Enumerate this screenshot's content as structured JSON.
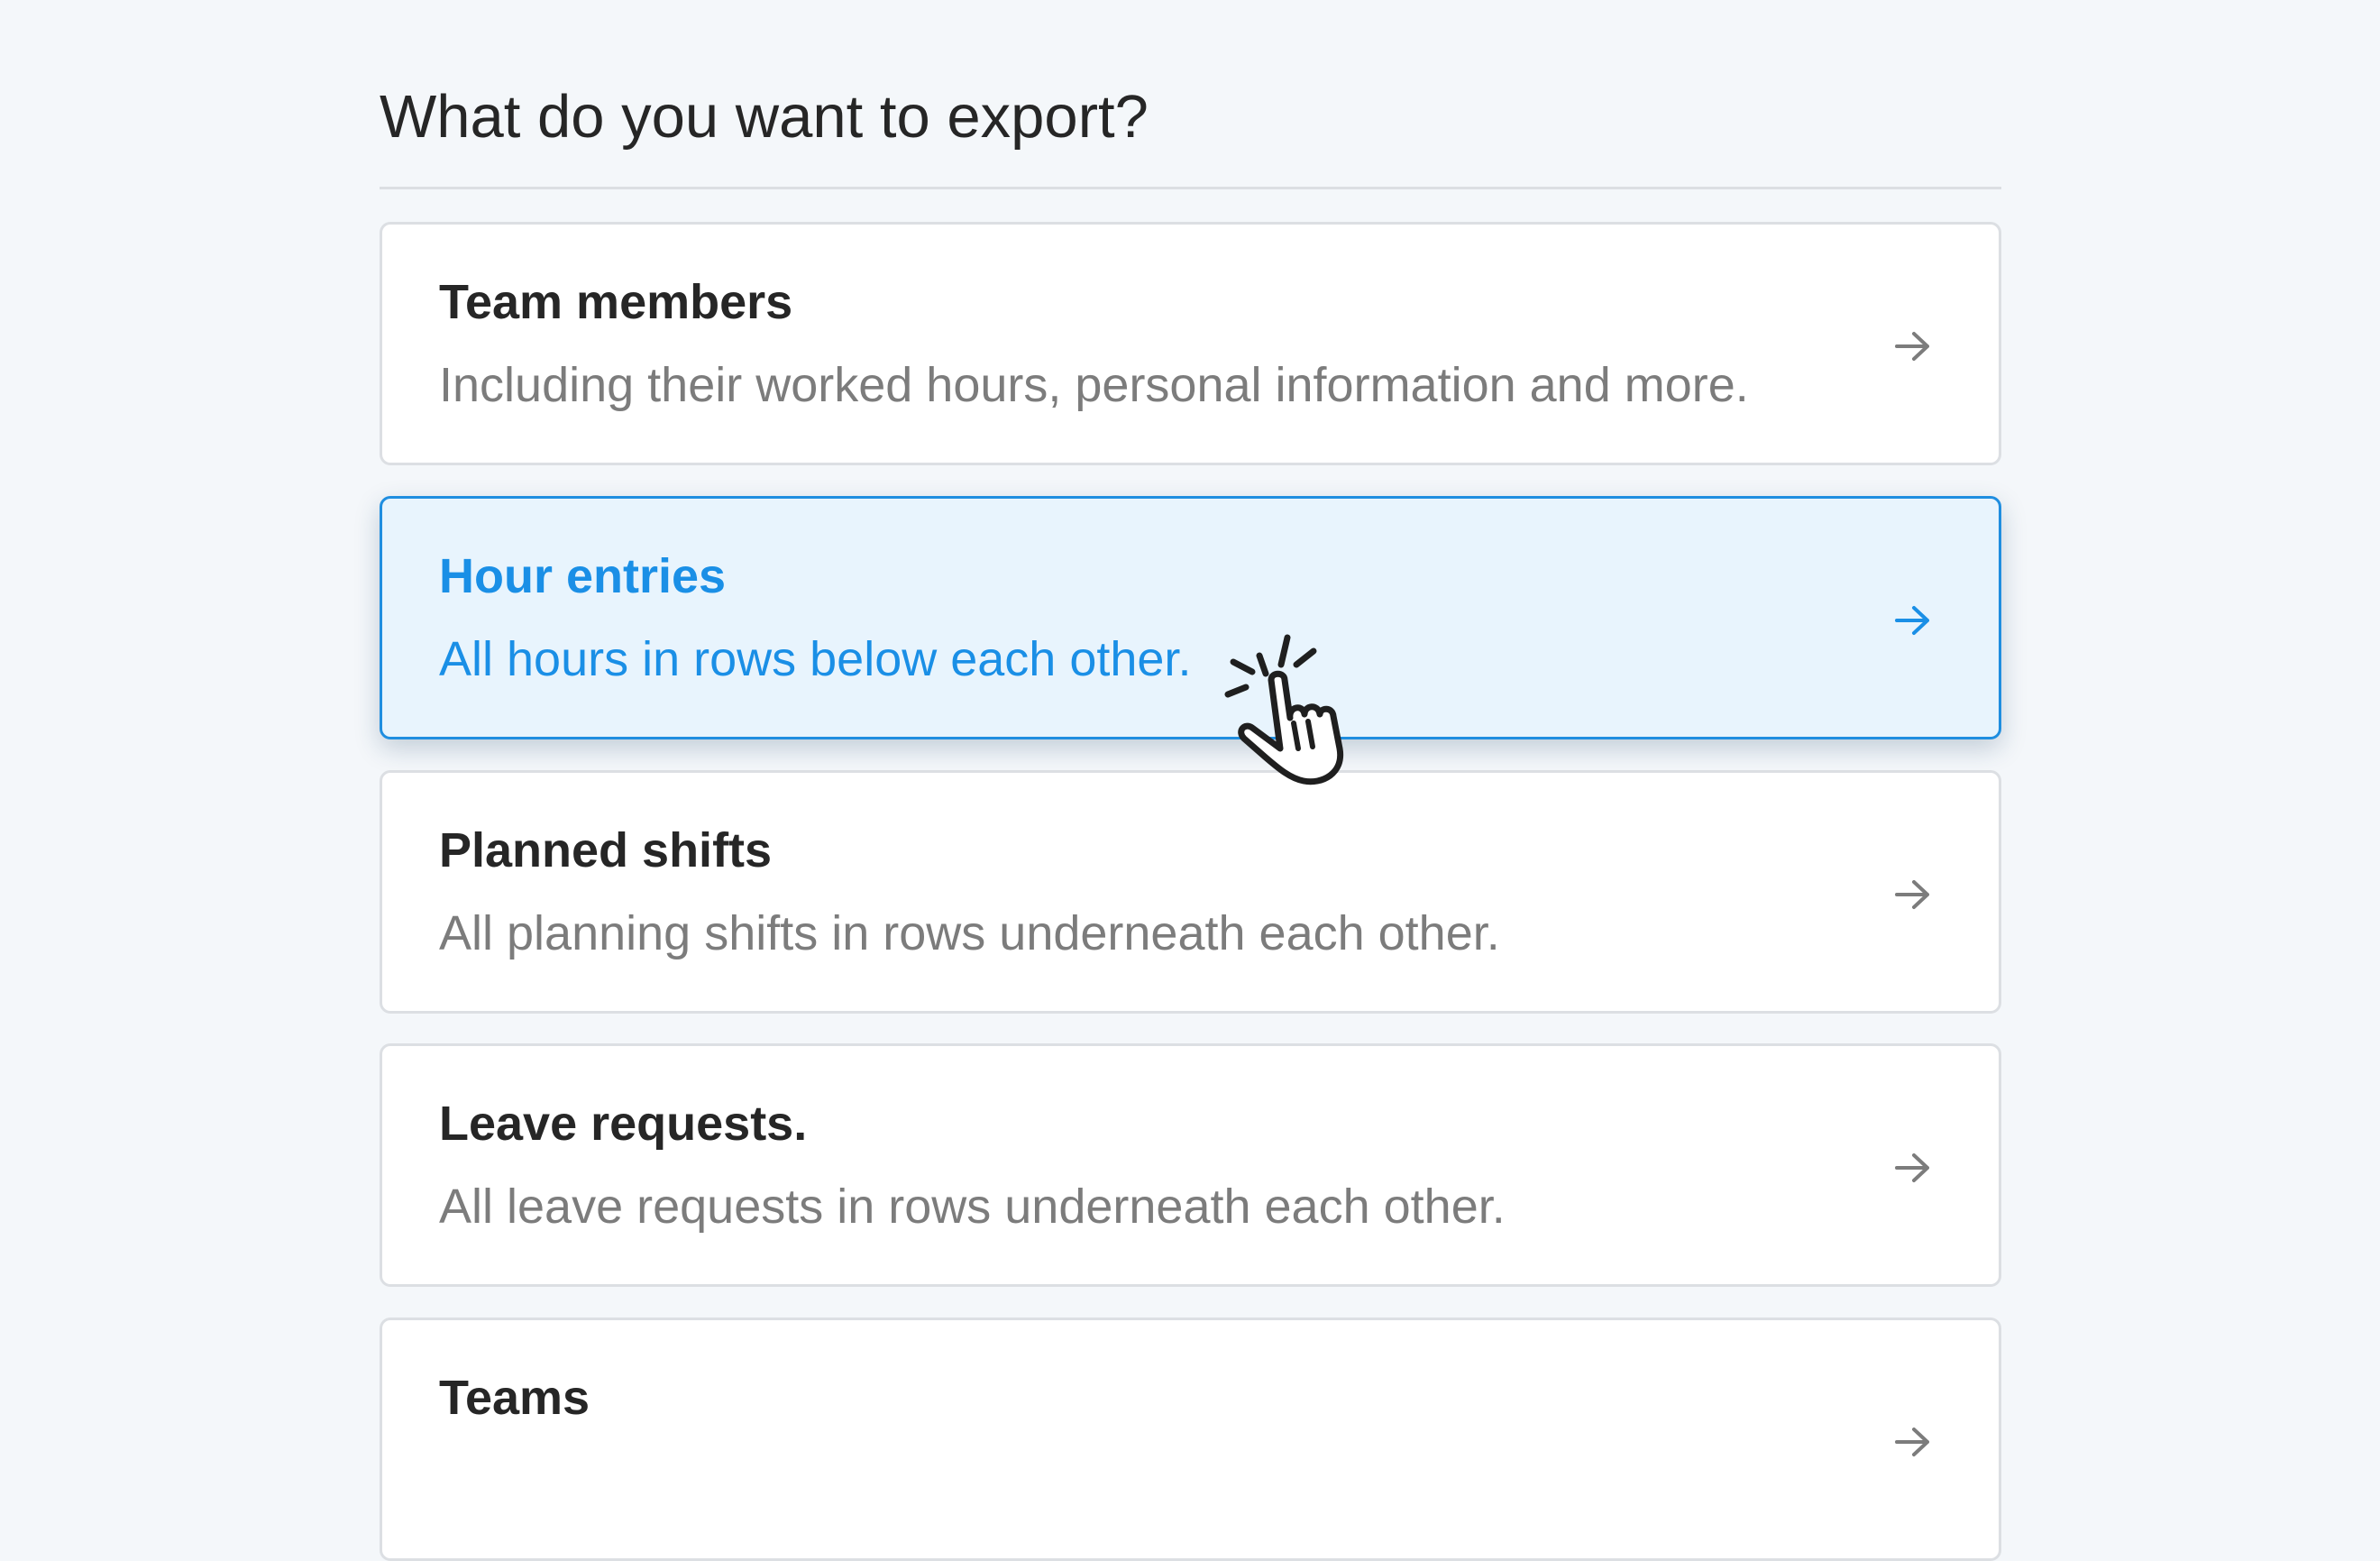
{
  "header": {
    "title": "What do you want to export?"
  },
  "options": [
    {
      "title": "Team members",
      "description": "Including their worked hours, personal information and more."
    },
    {
      "title": "Hour entries",
      "description": "All hours in rows below each other."
    },
    {
      "title": "Planned shifts",
      "description": "All planning shifts in rows underneath each other."
    },
    {
      "title": "Leave requests.",
      "description": "All leave requests in rows underneath each other."
    },
    {
      "title": "Teams",
      "description": ""
    }
  ],
  "selected_option": "Hour entries",
  "icons": {
    "option_arrow": "arrow-right-icon",
    "cursor": "pointer-hand-icon"
  },
  "colors": {
    "background": "#f4f7fa",
    "card_background": "#ffffff",
    "card_border": "#dcdfe3",
    "selected_background": "#e8f4fd",
    "selected_border": "#1f8ee0",
    "selected_text": "#1a8fe6",
    "title_text": "#262626",
    "muted_text": "#7c7c7c"
  }
}
